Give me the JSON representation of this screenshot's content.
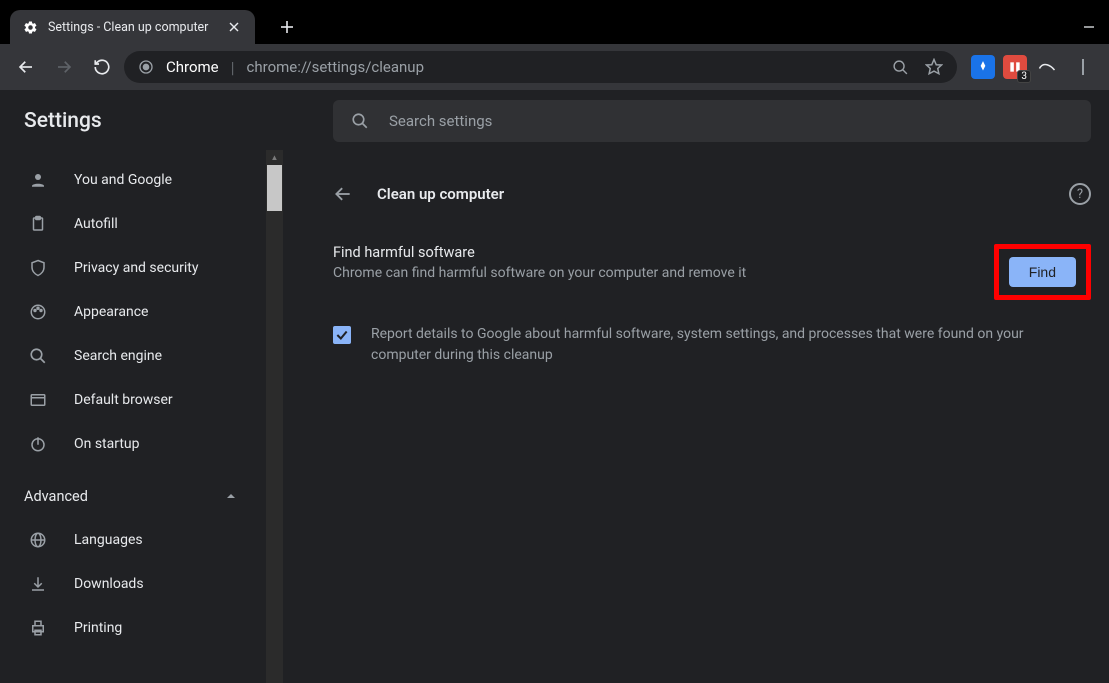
{
  "browser": {
    "tab_title": "Settings - Clean up computer",
    "omnibox_protocol": "Chrome",
    "omnibox_divider": "|",
    "omnibox_url": "chrome://settings/cleanup",
    "extension_badge": "3"
  },
  "sidebar": {
    "header": "Settings",
    "items": [
      {
        "label": "You and Google"
      },
      {
        "label": "Autofill"
      },
      {
        "label": "Privacy and security"
      },
      {
        "label": "Appearance"
      },
      {
        "label": "Search engine"
      },
      {
        "label": "Default browser"
      },
      {
        "label": "On startup"
      }
    ],
    "advanced_label": "Advanced",
    "advanced_items": [
      {
        "label": "Languages"
      },
      {
        "label": "Downloads"
      },
      {
        "label": "Printing"
      }
    ]
  },
  "main": {
    "search_placeholder": "Search settings",
    "page_title": "Clean up computer",
    "find_section": {
      "title": "Find harmful software",
      "subtitle": "Chrome can find harmful software on your computer and remove it",
      "button": "Find"
    },
    "report_checkbox": {
      "checked": true,
      "label": "Report details to Google about harmful software, system settings, and processes that were found on your computer during this cleanup"
    }
  }
}
